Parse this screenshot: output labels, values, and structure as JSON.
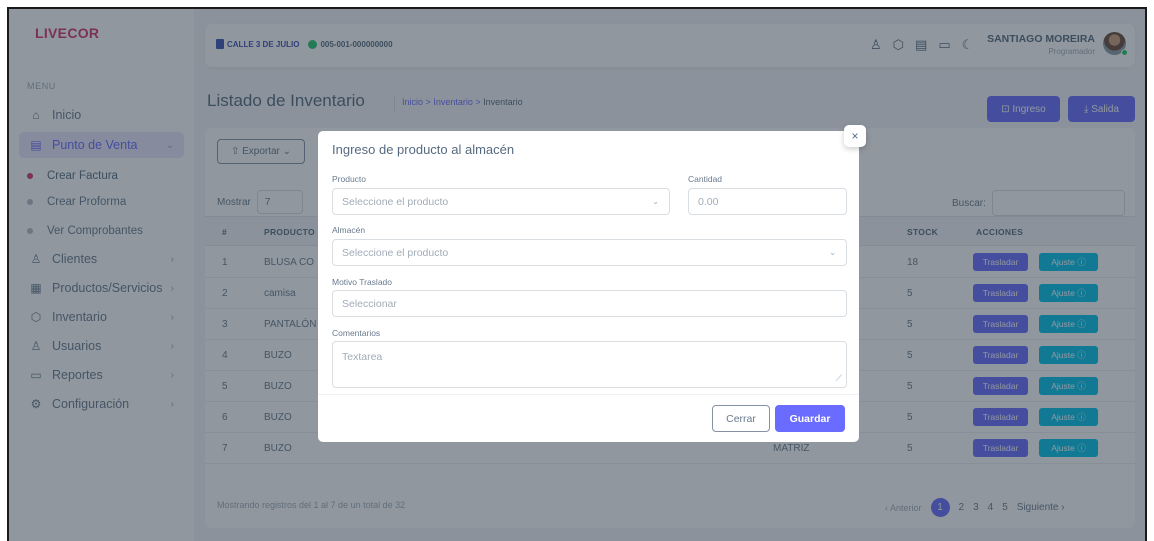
{
  "brand": "LIVECOR",
  "sidebar": {
    "menu_title": "MENU",
    "items": [
      {
        "label": "Inicio",
        "icon": "home-icon"
      },
      {
        "label": "Punto de Venta",
        "icon": "document-icon"
      },
      {
        "label": "Clientes",
        "icon": "user-icon"
      },
      {
        "label": "Productos/Servicios",
        "icon": "grid-icon"
      },
      {
        "label": "Inventario",
        "icon": "box-icon"
      },
      {
        "label": "Usuarios",
        "icon": "users-icon"
      },
      {
        "label": "Reportes",
        "icon": "archive-icon"
      },
      {
        "label": "Configuración",
        "icon": "settings-icon"
      }
    ],
    "subitems": [
      {
        "label": "Crear Factura"
      },
      {
        "label": "Crear Proforma"
      },
      {
        "label": "Ver Comprobantes"
      }
    ]
  },
  "topbar": {
    "location": "CALLE 3 DE JULIO",
    "account": "005-001-000000000",
    "user_name": "SANTIAGO MOREIRA",
    "user_role": "Programador"
  },
  "page": {
    "title": "Listado de Inventario",
    "breadcrumb": [
      "Inicio",
      ">",
      "Inventario",
      ">",
      "Inventario"
    ],
    "btn_ingreso": "⊡ Ingreso",
    "btn_salida": "⤓ Salida"
  },
  "table": {
    "export_label": "⇧ Exportar ⌄",
    "show_label": "Mostrar",
    "show_value": "7",
    "search_label": "Buscar:",
    "headers": {
      "num": "#",
      "producto": "PRODUCTO",
      "stock": "STOCK",
      "acciones": "ACCIONES"
    },
    "rows": [
      {
        "num": "1",
        "producto": "BLUSA CO",
        "almacen": "",
        "stock": "18"
      },
      {
        "num": "2",
        "producto": "camisa",
        "almacen": "",
        "stock": "5"
      },
      {
        "num": "3",
        "producto": "PANTALÓN",
        "almacen": "",
        "stock": "5"
      },
      {
        "num": "4",
        "producto": "BUZO",
        "almacen": "",
        "stock": "5"
      },
      {
        "num": "5",
        "producto": "BUZO",
        "almacen": "",
        "stock": "5"
      },
      {
        "num": "6",
        "producto": "BUZO",
        "almacen": "",
        "stock": "5"
      },
      {
        "num": "7",
        "producto": "BUZO",
        "almacen": "MATRIZ",
        "stock": "5"
      }
    ],
    "action_trasladar": "Trasladar",
    "action_ajuste": "Ajuste ⓘ",
    "footer": "Mostrando registros del 1 al 7 de un total de 32",
    "pager": {
      "prev": "‹ Anterior",
      "pages": [
        "1",
        "2",
        "3",
        "4",
        "5"
      ],
      "next": "Siguiente ›"
    }
  },
  "modal": {
    "title": "Ingreso de producto al almacén",
    "close": "×",
    "producto_label": "Producto",
    "producto_placeholder": "Seleccione el producto",
    "cantidad_label": "Cantidad",
    "cantidad_placeholder": "0.00",
    "almacen_label": "Almacén",
    "almacen_placeholder": "Seleccione el producto",
    "motivo_label": "Motivo Traslado",
    "motivo_placeholder": "Seleccionar",
    "comentarios_label": "Comentarios",
    "comentarios_placeholder": "Textarea",
    "cerrar": "Cerrar",
    "guardar": "Guardar"
  },
  "colors": {
    "primary": "#696cff",
    "info": "#03c3ec",
    "brand": "#d6336c",
    "online": "#28c76f"
  }
}
